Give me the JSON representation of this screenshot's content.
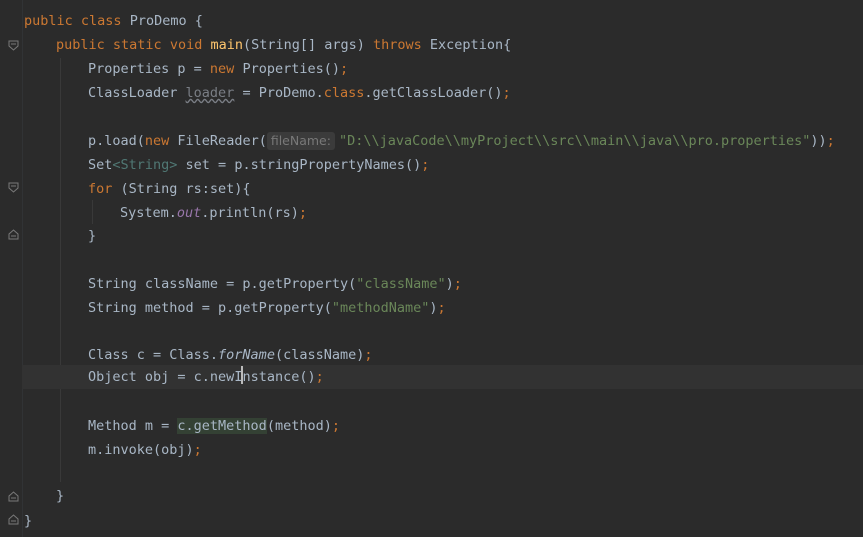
{
  "code": {
    "l1": {
      "kw1": "public ",
      "kw2": "class ",
      "name": "ProDemo {"
    },
    "l2": {
      "kw1": "public ",
      "kw2": "static ",
      "kw3": "void ",
      "method": "main",
      "params": "(String[] args) ",
      "kw4": "throws ",
      "rest": "Exception{"
    },
    "l3": {
      "a": "Properties p = ",
      "kw": "new ",
      "b": "Properties()",
      "semi": ";"
    },
    "l4": {
      "a": "ClassLoader ",
      "var": "loader",
      "b": " = ProDemo.",
      "kw": "class",
      "c": ".getClassLoader()",
      "semi": ";"
    },
    "l5": {
      "a": "p.load(",
      "kw": "new ",
      "b": "FileReader(",
      "hint": "fileName:",
      "str": "\"D:\\\\javaCode\\\\myProject\\\\src\\\\main\\\\java\\\\pro.properties\"",
      "c": "))",
      "semi": ";"
    },
    "l6": {
      "a": "Set",
      "tp": "<String>",
      "b": " set = p.stringPropertyNames()",
      "semi": ";"
    },
    "l7": {
      "kw": "for ",
      "b": "(String rs:set){"
    },
    "l8": {
      "a": "System.",
      "st": "out",
      "b": ".println(rs)",
      "semi": ";"
    },
    "l9": {
      "a": "}"
    },
    "l10": {
      "a": "String className = p.getProperty(",
      "str": "\"className\"",
      "b": ")",
      "semi": ";"
    },
    "l11": {
      "a": "String method = p.getProperty(",
      "str": "\"methodName\"",
      "b": ")",
      "semi": ";"
    },
    "l12": {
      "a": "Class c = Class.",
      "it": "forName",
      "b": "(className)",
      "semi": ";"
    },
    "l13": {
      "a": "Object obj = c.newI",
      "b": "nstance()",
      "semi": ";"
    },
    "l14": {
      "a": "Method m = ",
      "hl": "c.getMethod",
      "b": "(method)",
      "semi": ";"
    },
    "l15": {
      "a": "m.invoke(obj)",
      "semi": ";"
    },
    "l16": {
      "a": "}"
    },
    "l17": {
      "a": "}"
    }
  },
  "colors": {
    "background": "#2b2b2b",
    "keyword": "#cc7832",
    "string": "#6a8759",
    "method_decl": "#ffc66d",
    "static_field": "#9876aa",
    "default_text": "#a9b7c6"
  },
  "icons": [
    "fold-open-icon",
    "fold-close-icon"
  ]
}
